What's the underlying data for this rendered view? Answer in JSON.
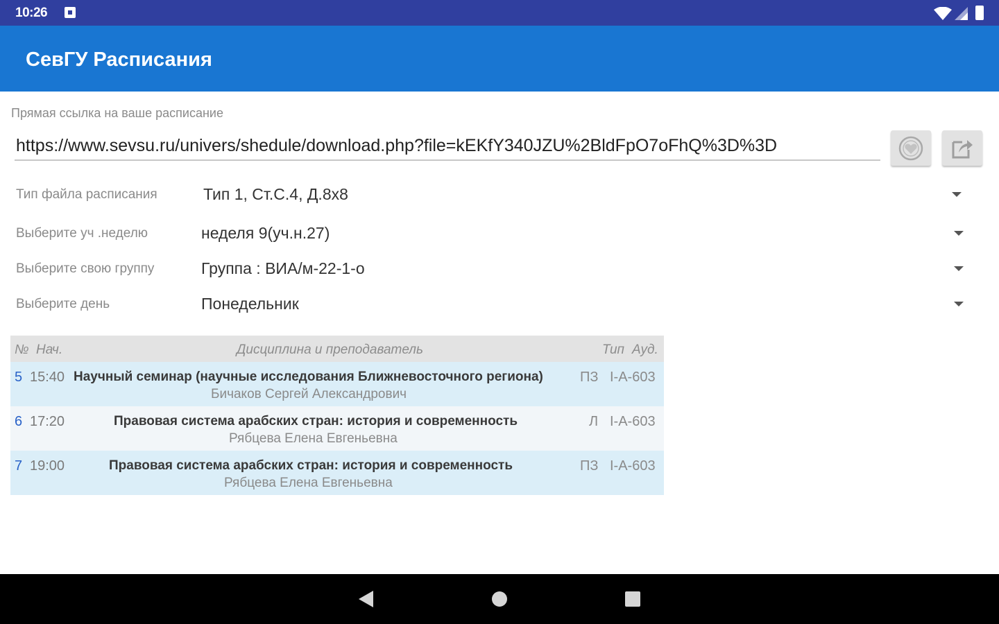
{
  "status_bar": {
    "time": "10:26"
  },
  "app_bar": {
    "title": "СевГУ Расписания"
  },
  "link": {
    "label": "Прямая ссылка на ваше расписание",
    "value": "https://www.sevsu.ru/univers/shedule/download.php?file=kEKfY340JZU%2BldFpO7oFhQ%3D%3D"
  },
  "buttons": {
    "favorite_icon": "favorite-icon",
    "share_icon": "share-icon"
  },
  "spinners": [
    {
      "label": "Тип файла расписания",
      "value": "Тип 1, Ст.С.4, Д.8х8"
    },
    {
      "label": "Выберите уч .неделю",
      "value": "неделя 9(уч.н.27)"
    },
    {
      "label": "Выберите свою группу",
      "value": "Группа : ВИА/м-22-1-о"
    },
    {
      "label": "Выберите день",
      "value": "Понедельник"
    }
  ],
  "schedule": {
    "headers": {
      "num": "№",
      "start": "Нач.",
      "discipline": "Дисциплина и преподаватель",
      "type": "Тип",
      "room": "Ауд."
    },
    "rows": [
      {
        "num": "5",
        "time": "15:40",
        "discipline": "Научный семинар (научные исследования Ближневосточного региона)",
        "teacher": "Бичаков Сергей Александрович",
        "type": "ПЗ",
        "room": "I-A-603"
      },
      {
        "num": "6",
        "time": "17:20",
        "discipline": "Правовая система арабских стран: история и современность",
        "teacher": "Рябцева Елена Евгеньевна",
        "type": "Л",
        "room": "I-A-603"
      },
      {
        "num": "7",
        "time": "19:00",
        "discipline": "Правовая система арабских стран: история и современность",
        "teacher": "Рябцева Елена Евгеньевна",
        "type": "ПЗ",
        "room": "I-A-603"
      }
    ]
  },
  "colors": {
    "status_bar": "#303f9f",
    "app_bar": "#1976d2",
    "row_highlight": "#dbeef8",
    "number_accent": "#2962c8"
  }
}
